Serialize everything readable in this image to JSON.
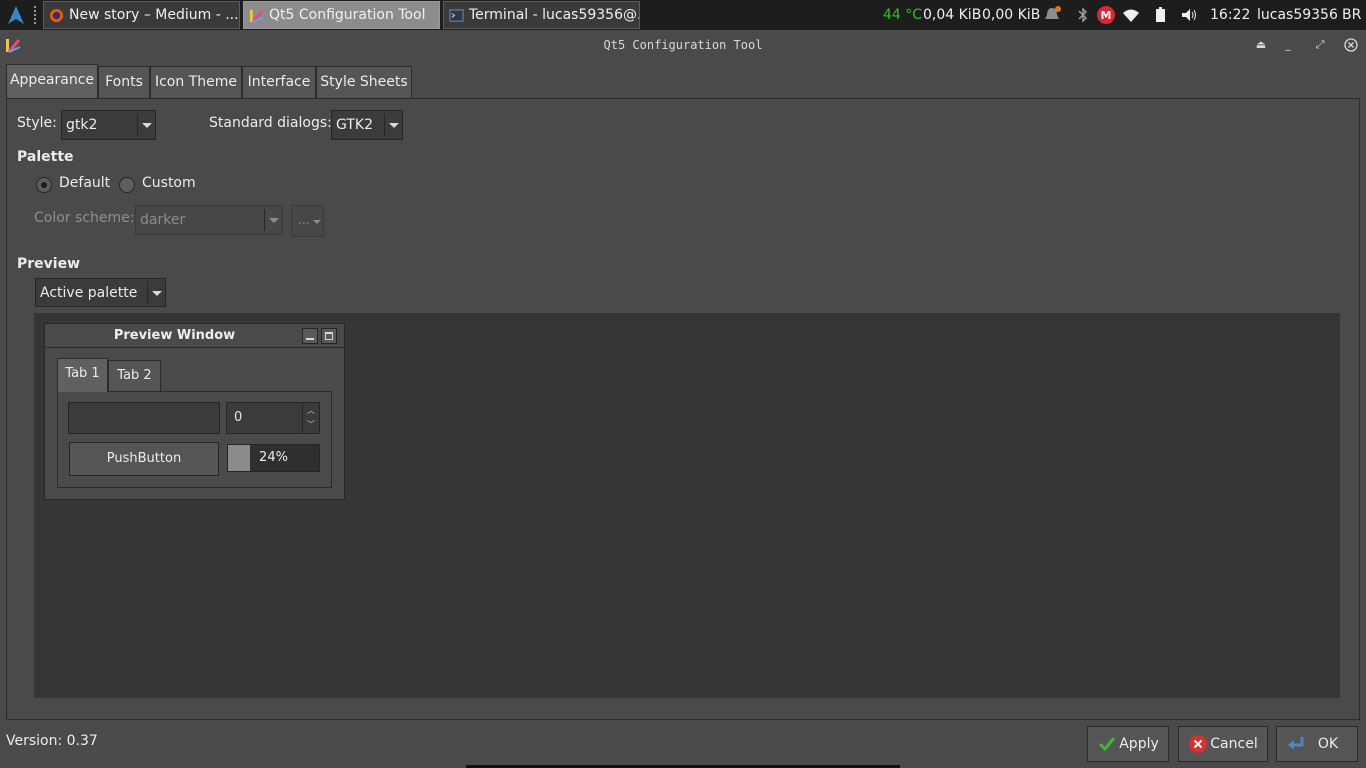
{
  "taskbar": {
    "tasks": [
      {
        "label": "New story – Medium - ...",
        "icon": "firefox-icon"
      },
      {
        "label": "Qt5 Configuration Tool",
        "icon": "qt5ct-icon"
      },
      {
        "label": "Terminal - lucas59356@...",
        "icon": "terminal-icon"
      }
    ],
    "temperature": "44 °C",
    "net_down": "0,04 KiB",
    "net_up": "0,00 KiB",
    "time": "16:22",
    "user": "lucas59356",
    "keyboard_layout": "BR"
  },
  "window": {
    "title": "Qt5 Configuration Tool"
  },
  "tabs": [
    {
      "label": "Appearance"
    },
    {
      "label": "Fonts"
    },
    {
      "label": "Icon Theme"
    },
    {
      "label": "Interface"
    },
    {
      "label": "Style Sheets"
    }
  ],
  "appearance": {
    "style_label": "Style:",
    "style_value": "gtk2",
    "dialogs_label": "Standard dialogs:",
    "dialogs_value": "GTK2",
    "palette_heading": "Palette",
    "radio_default": "Default",
    "radio_custom": "Custom",
    "palette_selected": "Default",
    "color_scheme_label": "Color scheme:",
    "color_scheme_value": "darker",
    "scheme_menu_label": "...",
    "preview_heading": "Preview",
    "preview_palette_value": "Active palette"
  },
  "preview_window": {
    "title": "Preview Window",
    "tab1": "Tab 1",
    "tab2": "Tab 2",
    "line_edit_value": "",
    "spin_value": "0",
    "push_button": "PushButton",
    "progress_text": "24%",
    "progress_value": 0.24
  },
  "footer": {
    "version": "Version: 0.37",
    "apply": "Apply",
    "cancel": "Cancel",
    "ok": "OK"
  },
  "colors": {
    "background": "#4a4a4a",
    "panel": "#1d1d1d",
    "temperature": "#27c427",
    "mega": "#d9272e",
    "apply_check": "#3cb93c",
    "cancel_x": "#d4302f",
    "ok_arrow": "#4f86c9"
  }
}
